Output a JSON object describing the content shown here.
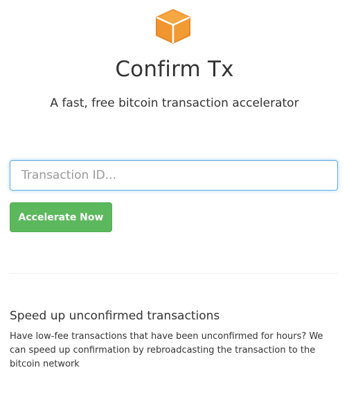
{
  "header": {
    "logo_icon": "box-icon",
    "logo_color": "#f0952f",
    "title": "Confirm Tx",
    "subtitle": "A fast, free bitcoin transaction accelerator"
  },
  "form": {
    "txid_placeholder": "Transaction ID...",
    "txid_value": "",
    "submit_label": "Accelerate Now",
    "submit_color": "#5cb85c"
  },
  "info": {
    "heading": "Speed up unconfirmed transactions",
    "body": "Have low-fee transactions that have been unconfirmed for hours? We can speed up confirmation by rebroadcasting the transaction to the bitcoin network"
  }
}
